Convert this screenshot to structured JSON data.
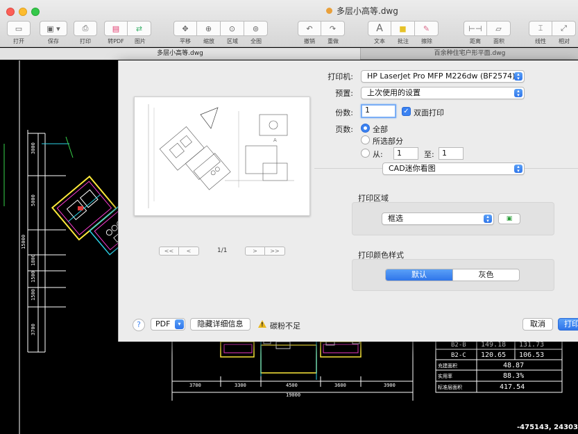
{
  "window": {
    "title": "多层小高等.dwg"
  },
  "toolbar": {
    "items": [
      {
        "label": "打开",
        "icon": "folder-icon"
      },
      {
        "label": "保存",
        "icon": "save-icon"
      },
      {
        "label": "打印",
        "icon": "printer-icon"
      },
      {
        "label": "转PDF",
        "icon": "pdf-icon"
      },
      {
        "label": "图片",
        "icon": "image-icon"
      },
      {
        "label": "平移",
        "icon": "pan-icon"
      },
      {
        "label": "缩放",
        "icon": "zoom-icon"
      },
      {
        "label": "区域",
        "icon": "zoom-area-icon"
      },
      {
        "label": "全图",
        "icon": "zoom-extents-icon"
      },
      {
        "label": "撤销",
        "icon": "undo-icon"
      },
      {
        "label": "重做",
        "icon": "redo-icon"
      },
      {
        "label": "文本",
        "icon": "text-icon"
      },
      {
        "label": "批注",
        "icon": "annotation-icon"
      },
      {
        "label": "擦除",
        "icon": "eraser-icon"
      },
      {
        "label": "距离",
        "icon": "distance-icon"
      },
      {
        "label": "面积",
        "icon": "area-icon"
      },
      {
        "label": "线性",
        "icon": "linear-icon"
      },
      {
        "label": "相对",
        "icon": "relative-icon"
      }
    ]
  },
  "tabs": [
    {
      "label": "多层小高等.dwg",
      "active": true
    },
    {
      "label": "百余种住宅户形平面.dwg",
      "active": false
    }
  ],
  "cad": {
    "left_dims": [
      "3000",
      "5000",
      "15000",
      "1800",
      "1500",
      "1500",
      "3700"
    ],
    "bottom_dims": [
      "3700",
      "3300",
      "4500",
      "3600",
      "3900"
    ],
    "bottom_total": "19000",
    "plan_label": "A",
    "table_rows": [
      [
        "B2-B",
        "149.18",
        "131.73"
      ],
      [
        "B2-C",
        "120.65",
        "106.53"
      ],
      [
        "充建面积",
        "48.87",
        ""
      ],
      [
        "实用率",
        "88.3%",
        ""
      ],
      [
        "标准层面积",
        "417.54",
        ""
      ]
    ],
    "coordinates": "-475143, 243034"
  },
  "print_dialog": {
    "printer_label": "打印机:",
    "printer_value": "HP LaserJet Pro MFP M226dw (BF2574)",
    "preset_label": "预置:",
    "preset_value": "上次使用的设置",
    "copies_label": "份数:",
    "copies_value": "1",
    "duplex_label": "双面打印",
    "duplex_checked": true,
    "pages_label": "页数:",
    "pages_all": "全部",
    "pages_selection": "所选部分",
    "pages_from_label": "从:",
    "pages_from_value": "1",
    "pages_to_label": "至:",
    "pages_to_value": "1",
    "section_popup": "CAD迷你看图",
    "print_area_title": "打印区域",
    "print_area_value": "框选",
    "color_style_title": "打印颜色样式",
    "color_default": "默认",
    "color_gray": "灰色",
    "page_indicator": "1/1",
    "pager": {
      "first": "<<",
      "prev": "<",
      "next": ">",
      "last": ">>"
    },
    "help": "?",
    "pdf_button": "PDF",
    "hide_details": "隐藏详细信息",
    "warning": "碳粉不足",
    "cancel": "取消",
    "print": "打印"
  }
}
